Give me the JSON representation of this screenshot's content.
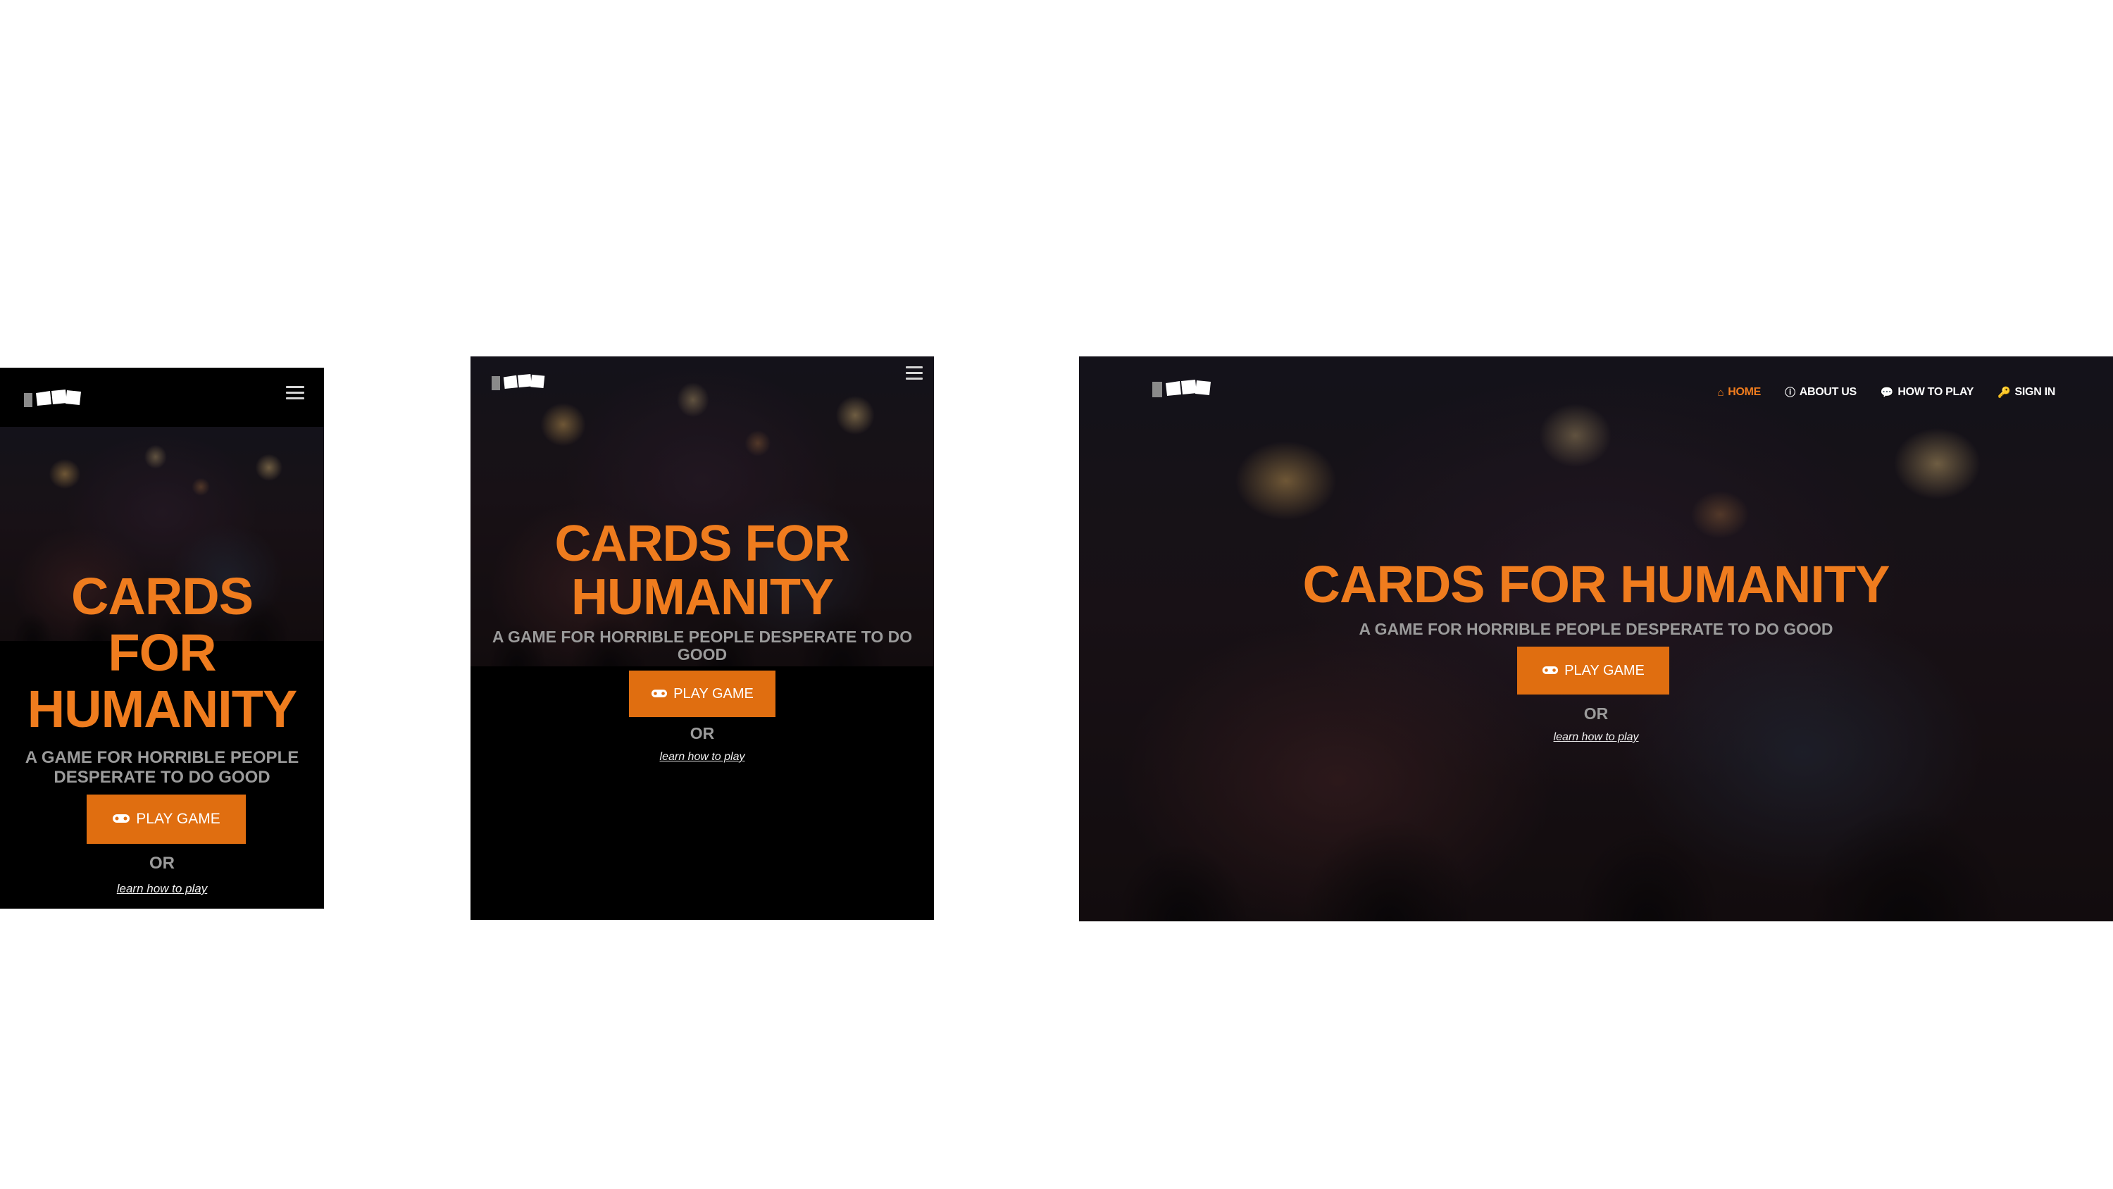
{
  "brand": {
    "logo": "cards-logo"
  },
  "hero": {
    "title": "CARDS FOR HUMANITY",
    "title_lines_mobile": [
      "CARDS",
      "FOR",
      "HUMANITY"
    ],
    "title_lines_tablet": [
      "CARDS FOR",
      "HUMANITY"
    ],
    "tagline": "A GAME FOR HORRIBLE PEOPLE DESPERATE TO DO GOOD",
    "tagline_lines_mobile": [
      "A GAME FOR HORRIBLE PEOPLE",
      "DESPERATE TO DO GOOD"
    ],
    "tagline_lines_tablet": [
      "A GAME FOR HORRIBLE PEOPLE DESPERATE TO DO",
      "GOOD"
    ],
    "play_button": "PLAY GAME",
    "or": "OR",
    "learn_link": "learn how to play"
  },
  "nav": {
    "items": [
      {
        "label": "HOME",
        "icon": "home-icon",
        "active": true
      },
      {
        "label": "ABOUT US",
        "icon": "info-icon"
      },
      {
        "label": "HOW TO PLAY",
        "icon": "chat-icon"
      },
      {
        "label": "SIGN IN",
        "icon": "key-icon"
      }
    ]
  },
  "colors": {
    "accent": "#ef7c1e",
    "button": "#e06e10",
    "muted": "#9b9b9b"
  }
}
